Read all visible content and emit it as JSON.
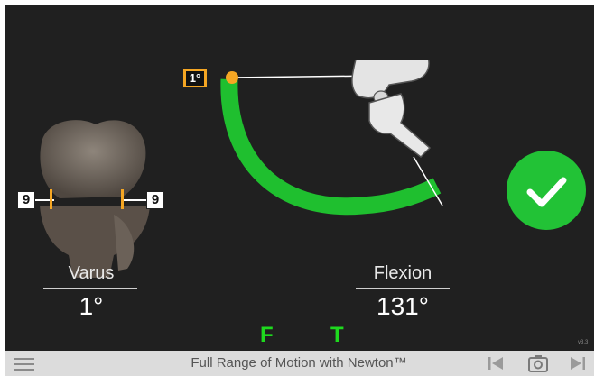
{
  "varus": {
    "label": "Varus",
    "value": "1°",
    "left_gap": "9",
    "right_gap": "9"
  },
  "flexion": {
    "label": "Flexion",
    "value": "131°",
    "indicator": "1°"
  },
  "indicators": {
    "femur": "F",
    "tibia": "T"
  },
  "version": "v3.3",
  "bottom_bar": {
    "title": "Full Range of Motion with Newton™"
  },
  "colors": {
    "arc": "#1fbf2f",
    "confirm": "#22c236",
    "marker": "#f5a623",
    "letters": "#1ed91e"
  }
}
